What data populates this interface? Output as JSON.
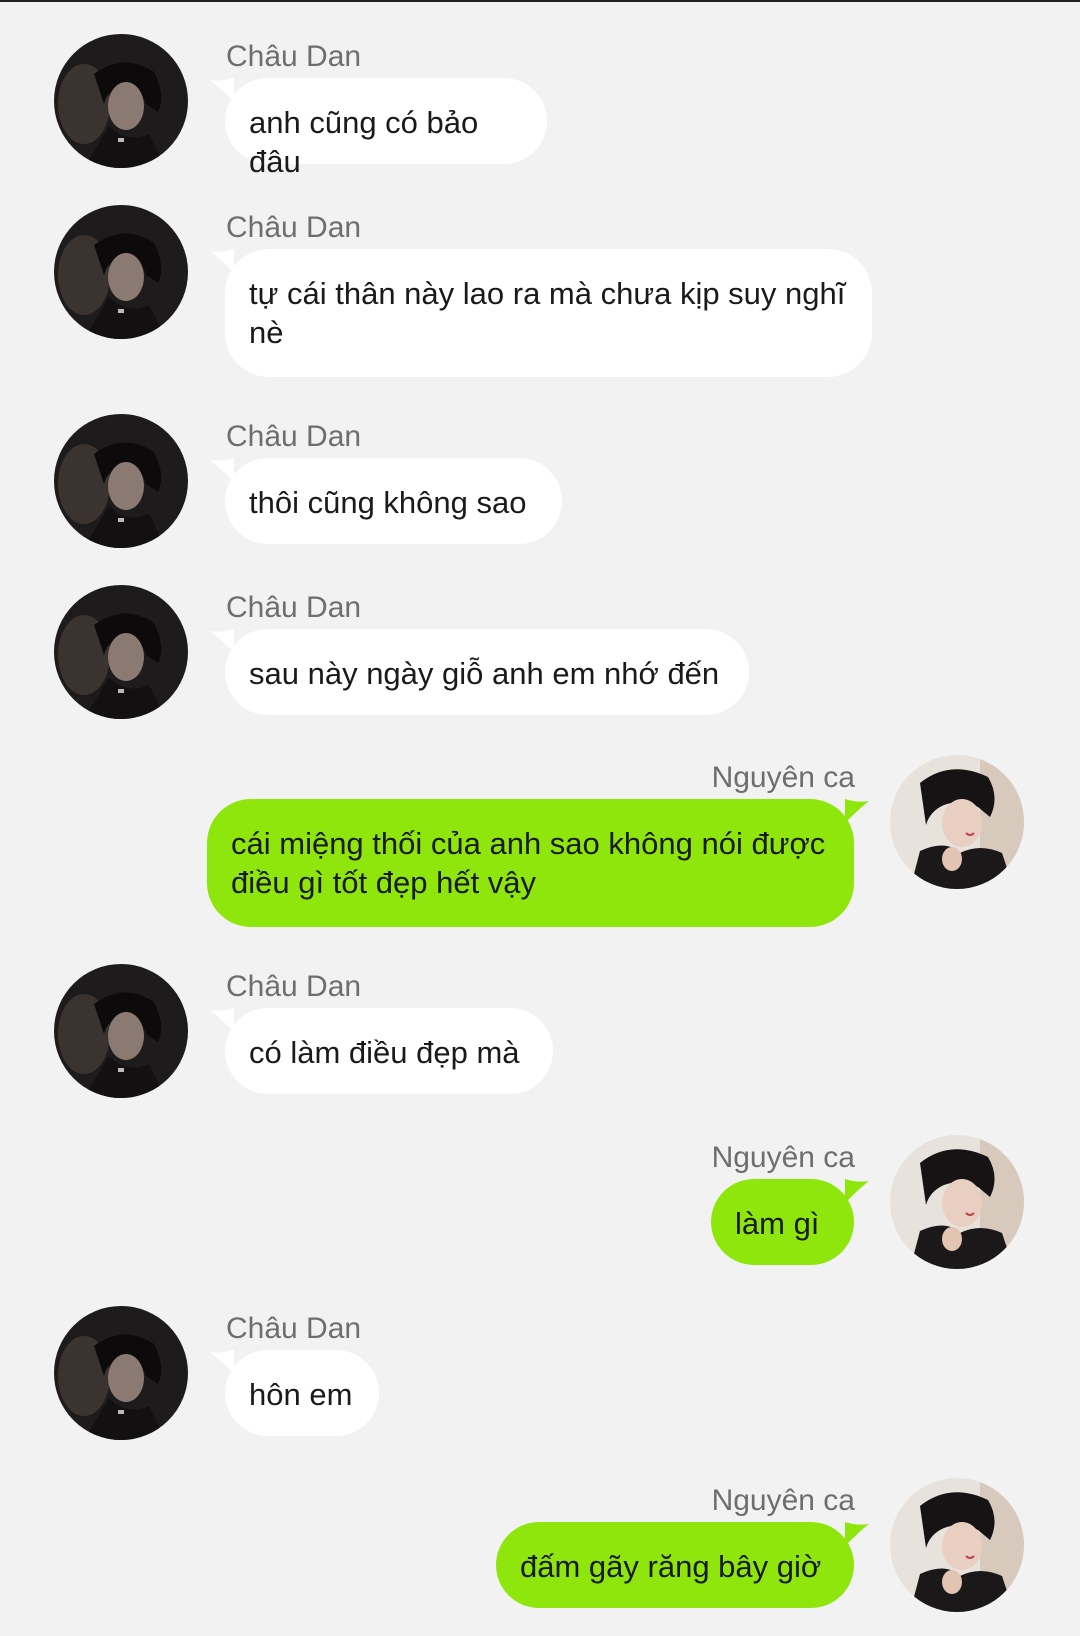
{
  "participants": {
    "other_name": "Châu Dan",
    "self_name": "Nguyên ca"
  },
  "messages": [
    {
      "sender": "Châu Dan",
      "side": "left",
      "text": "anh cũng có bảo đâu"
    },
    {
      "sender": "Châu Dan",
      "side": "left",
      "text": "tự cái thân này lao ra mà chưa kịp suy nghĩ nè"
    },
    {
      "sender": "Châu Dan",
      "side": "left",
      "text": "thôi cũng không sao"
    },
    {
      "sender": "Châu Dan",
      "side": "left",
      "text": "sau này ngày giỗ anh em nhớ đến"
    },
    {
      "sender": "Nguyên ca",
      "side": "right",
      "text": "cái miệng thối của anh sao không nói được điều gì tốt đẹp hết vậy"
    },
    {
      "sender": "Châu Dan",
      "side": "left",
      "text": "có làm điều đẹp mà"
    },
    {
      "sender": "Nguyên ca",
      "side": "right",
      "text": "làm gì"
    },
    {
      "sender": "Châu Dan",
      "side": "left",
      "text": "hôn em"
    },
    {
      "sender": "Nguyên ca",
      "side": "right",
      "text": "đấm gãy răng bây giờ"
    }
  ],
  "colors": {
    "background": "#f2f2f2",
    "incoming_bubble": "#ffffff",
    "outgoing_bubble": "#8ee60d",
    "name_text": "#6e6e6e"
  },
  "icons": {
    "left_avatar": "avatar-dark-portrait",
    "right_avatar": "avatar-light-portrait"
  }
}
